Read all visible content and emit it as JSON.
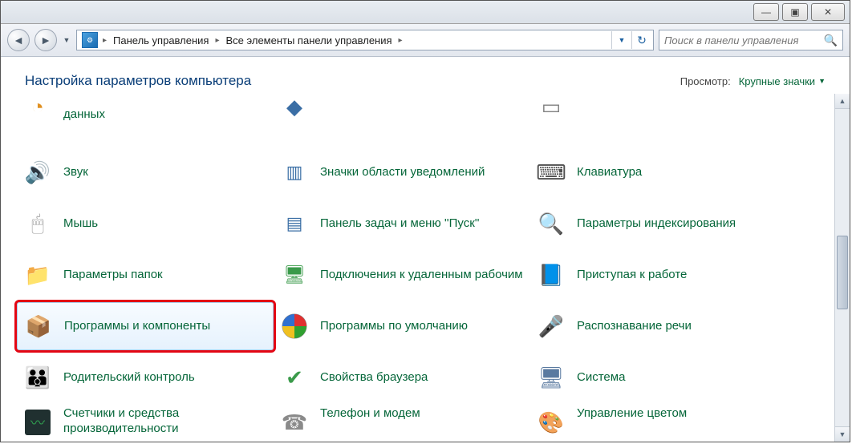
{
  "window_controls": {
    "minimize": "—",
    "maximize": "▣",
    "close": "✕"
  },
  "breadcrumb": {
    "sep": "▸",
    "items": [
      "Панель управления",
      "Все элементы панели управления"
    ]
  },
  "search": {
    "placeholder": "Поиск в панели управления"
  },
  "page_title": "Настройка параметров компьютера",
  "view": {
    "label": "Просмотр:",
    "value": "Крупные значки"
  },
  "items": {
    "col1": [
      {
        "label": "данных",
        "partial": "top",
        "icon": "data-icon"
      },
      {
        "label": "Звук",
        "icon": "sound-icon"
      },
      {
        "label": "Мышь",
        "icon": "mouse-icon"
      },
      {
        "label": "Параметры папок",
        "icon": "folder-options-icon"
      },
      {
        "label": "Программы и компоненты",
        "icon": "programs-icon",
        "selected": true,
        "highlighted": true
      },
      {
        "label": "Родительский контроль",
        "icon": "parental-icon"
      },
      {
        "label": "Счетчики и средства производительности",
        "icon": "performance-icon",
        "partial": "bottom"
      }
    ],
    "col2": [
      {
        "label": "",
        "partial": "top",
        "icon": "generic-icon"
      },
      {
        "label": "Значки области уведомлений",
        "icon": "notification-icon"
      },
      {
        "label": "Панель задач и меню ''Пуск''",
        "icon": "taskbar-icon"
      },
      {
        "label": "Подключения к удаленным рабочим",
        "icon": "remote-icon"
      },
      {
        "label": "Программы по умолчанию",
        "icon": "defaults-icon"
      },
      {
        "label": "Свойства браузера",
        "icon": "browser-icon"
      },
      {
        "label": "Телефон и модем",
        "icon": "phone-icon",
        "partial": "bottom"
      }
    ],
    "col3": [
      {
        "label": "",
        "partial": "top",
        "icon": "generic-icon"
      },
      {
        "label": "Клавиатура",
        "icon": "keyboard-icon"
      },
      {
        "label": "Параметры индексирования",
        "icon": "indexing-icon"
      },
      {
        "label": "Приступая к работе",
        "icon": "getting-started-icon"
      },
      {
        "label": "Распознавание речи",
        "icon": "speech-icon"
      },
      {
        "label": "Система",
        "icon": "system-icon"
      },
      {
        "label": "Управление цветом",
        "icon": "color-icon",
        "partial": "bottom"
      }
    ]
  }
}
